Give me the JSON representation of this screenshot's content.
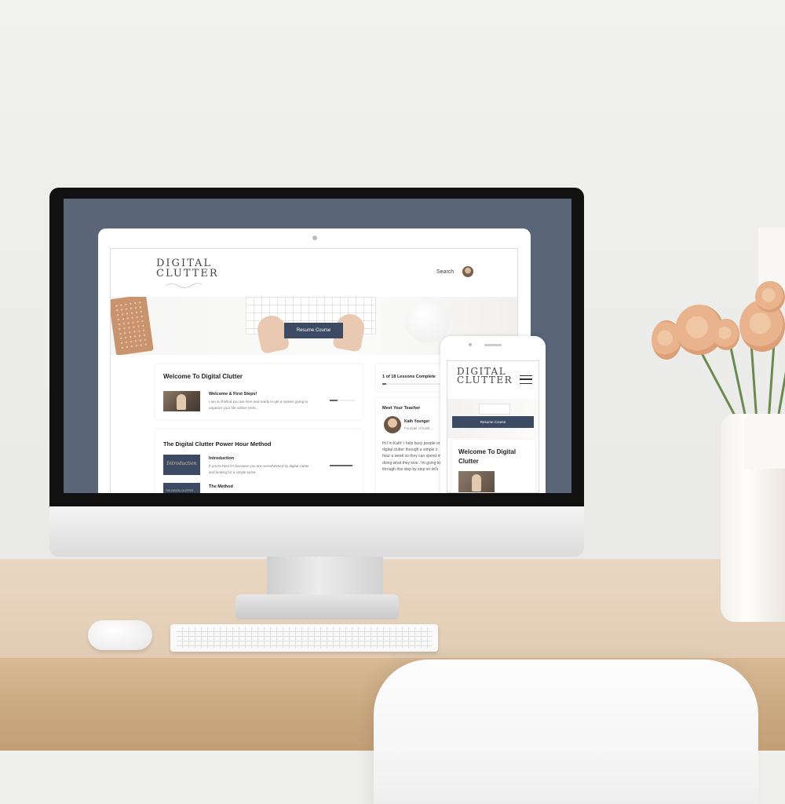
{
  "logo": {
    "line1": "DIGITAL",
    "line2": "CLUTTER"
  },
  "nav": {
    "search_label": "Search"
  },
  "hero": {
    "resume_label": "Resume Course"
  },
  "modules": [
    {
      "title": "Welcome To Digital Clutter",
      "lessons": [
        {
          "title": "Welcome & First Steps!",
          "desc_line1": "I am so thrilled you are here and ready to get a system going to",
          "desc_line2": "organize your file online! Here...",
          "progress": 0.3
        }
      ]
    },
    {
      "title": "The Digital Clutter Power Hour Method",
      "lessons": [
        {
          "title": "Introduction",
          "thumb_label": "Introduction",
          "desc_line1": "If you're here it's because you are overwhelmed by digital clutter",
          "desc_line2": "and looking for a simple syste...",
          "progress": 0.9
        },
        {
          "title": "The Method",
          "thumb_label": "THE DIGITAL CLUTTER"
        }
      ]
    }
  ],
  "sidebar": {
    "lessons_complete": "1 of 18 Lessons Complete",
    "progress": 0.06,
    "teacher_heading": "Meet Your Teacher",
    "teacher_name": "Kath Younger",
    "teacher_role": "Founder of Kath...",
    "bio": [
      "Hi I'm Kath! I help busy people or",
      "digital clutter through a simple s",
      "hour a week so they can spend m",
      "doing what they love. I'm going to",
      "through this step by step so let's"
    ]
  },
  "phone": {
    "logo_line1": "DIGITAL",
    "logo_line2": "CLUTTER",
    "resume_label": "Resume Course",
    "card_title": "Welcome To Digital Clutter"
  },
  "colors": {
    "accent": "#3d4a63",
    "screen_bg": "#5a6677"
  }
}
